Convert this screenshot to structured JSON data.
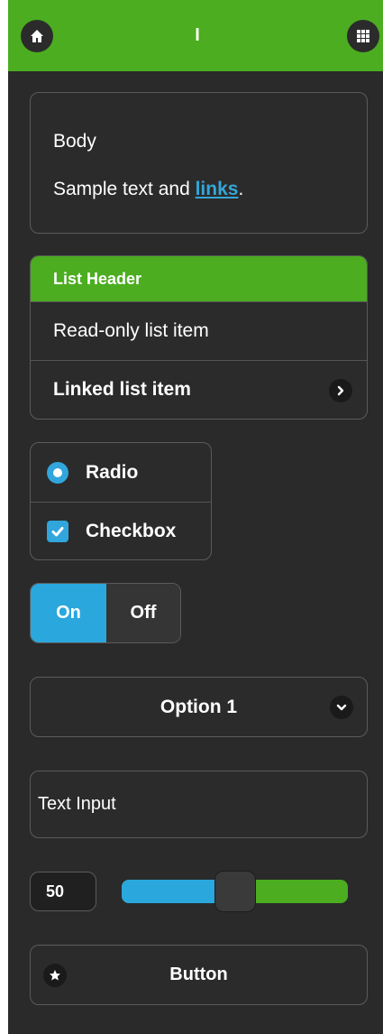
{
  "header": {
    "title": "I",
    "home_icon": "home-icon",
    "grid_icon": "grid-icon"
  },
  "body_card": {
    "title": "Body",
    "text_prefix": "Sample text and ",
    "link_text": "links",
    "text_suffix": "."
  },
  "list": {
    "header": "List Header",
    "items": [
      {
        "label": "Read-only list item"
      },
      {
        "label": "Linked list item",
        "icon": "chevron-right-icon"
      }
    ]
  },
  "choices": {
    "radio_label": "Radio",
    "checkbox_label": "Checkbox"
  },
  "switch": {
    "on_label": "On",
    "off_label": "Off"
  },
  "select": {
    "selected": "Option 1",
    "icon": "chevron-down-icon"
  },
  "text_input": {
    "placeholder": "Text Input"
  },
  "slider": {
    "value": "50",
    "min": 0,
    "max": 100,
    "level": 50
  },
  "button": {
    "label": "Button",
    "icon": "star-icon"
  },
  "colors": {
    "header_bg": "#4bad1f",
    "accent_blue": "#2aa7dd",
    "app_bg": "#2a2a2a",
    "link": "#34a6d8"
  }
}
